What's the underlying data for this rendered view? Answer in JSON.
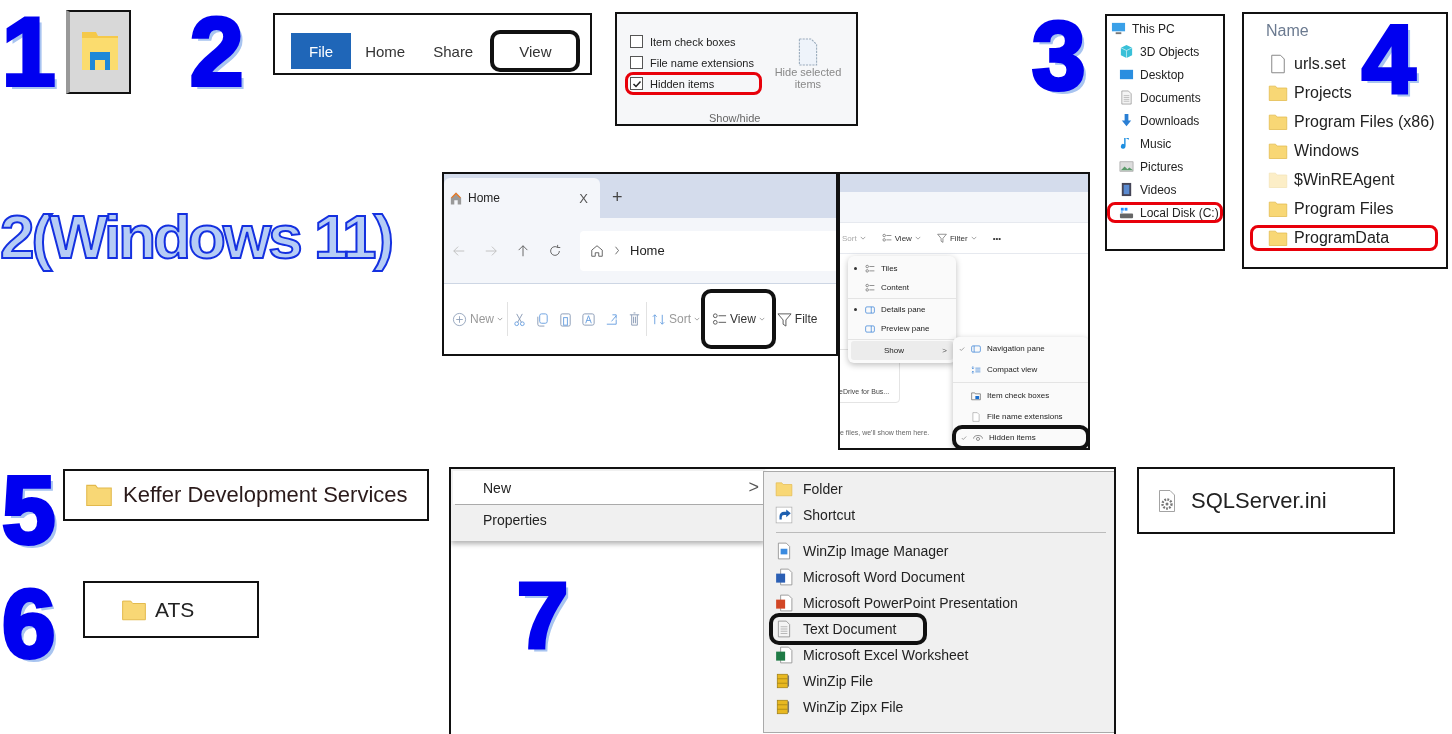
{
  "explorer_icon_step": {
    "step": "1"
  },
  "ribbon_step": {
    "step": "2",
    "tabs": [
      {
        "label": "File",
        "kind": "backstage",
        "highlighted": false
      },
      {
        "label": "Home",
        "kind": "tab",
        "highlighted": false
      },
      {
        "label": "Share",
        "kind": "tab",
        "highlighted": false
      },
      {
        "label": "View",
        "kind": "tab",
        "highlighted": true
      }
    ]
  },
  "show_hide_group": {
    "options": [
      {
        "label": "Item check boxes",
        "checked": false,
        "highlighted": false
      },
      {
        "label": "File name extensions",
        "checked": false,
        "highlighted": false
      },
      {
        "label": "Hidden items",
        "checked": true,
        "highlighted": true
      }
    ],
    "button": "Hide selected items",
    "group_label": "Show/hide"
  },
  "navigation_step": {
    "step": "3",
    "items": [
      {
        "label": "This PC",
        "kind": "pc",
        "highlighted": false
      },
      {
        "label": "3D Objects",
        "kind": "cube",
        "highlighted": false
      },
      {
        "label": "Desktop",
        "kind": "desktop",
        "highlighted": false
      },
      {
        "label": "Documents",
        "kind": "documents",
        "highlighted": false
      },
      {
        "label": "Downloads",
        "kind": "download",
        "highlighted": false
      },
      {
        "label": "Music",
        "kind": "music",
        "highlighted": false
      },
      {
        "label": "Pictures",
        "kind": "pictures",
        "highlighted": false
      },
      {
        "label": "Videos",
        "kind": "videos",
        "highlighted": false
      },
      {
        "label": "Local Disk (C:)",
        "kind": "drive",
        "highlighted": true
      }
    ]
  },
  "folder_list_step": {
    "step": "4",
    "header": "Name",
    "items": [
      {
        "name": "urls.set",
        "kind": "file",
        "hidden": false,
        "highlighted": false
      },
      {
        "name": "Projects",
        "kind": "folder",
        "hidden": false,
        "highlighted": false
      },
      {
        "name": "Program Files (x86)",
        "kind": "folder",
        "hidden": false,
        "highlighted": false
      },
      {
        "name": "Windows",
        "kind": "folder",
        "hidden": false,
        "highlighted": false
      },
      {
        "name": "$WinREAgent",
        "kind": "folder",
        "hidden": true,
        "highlighted": false
      },
      {
        "name": "Program Files",
        "kind": "folder",
        "hidden": false,
        "highlighted": false
      },
      {
        "name": "ProgramData",
        "kind": "folder",
        "hidden": false,
        "highlighted": true
      }
    ]
  },
  "windows11_step": {
    "title": "2(Windows 11)",
    "tab": {
      "label": "Home",
      "close": "X",
      "new_tab": "+"
    },
    "address": "Home",
    "toolbar": [
      {
        "label": "New",
        "kind": "new",
        "highlighted": false
      },
      {
        "kind": "cut",
        "highlighted": false
      },
      {
        "kind": "copy",
        "highlighted": false
      },
      {
        "kind": "paste",
        "highlighted": false
      },
      {
        "kind": "rename",
        "highlighted": false
      },
      {
        "kind": "share",
        "highlighted": false
      },
      {
        "kind": "delete",
        "highlighted": false
      },
      {
        "label": "Sort",
        "kind": "sort",
        "highlighted": false
      },
      {
        "label": "View",
        "kind": "view",
        "highlighted": true
      },
      {
        "label": "Filte",
        "kind": "filter",
        "highlighted": false
      }
    ]
  },
  "view_menu": {
    "toolbar": [
      {
        "label": "Sort",
        "kind": "sort"
      },
      {
        "label": "View",
        "kind": "view"
      },
      {
        "label": "Filter",
        "kind": "filter"
      },
      {
        "label": "•••",
        "kind": "more"
      }
    ],
    "card_text": "eDrive for Bus...",
    "empty_text": "e files, we'll show them here.",
    "items": [
      {
        "label": "Tiles",
        "kind": "tiles",
        "bullet": true,
        "selected": false
      },
      {
        "label": "Content",
        "kind": "content",
        "bullet": false,
        "selected": false
      },
      {
        "label": "Details pane",
        "kind": "details-pane",
        "bullet": true,
        "selected": false
      },
      {
        "label": "Preview pane",
        "kind": "preview-pane",
        "bullet": false,
        "selected": false
      },
      {
        "label": "Show",
        "kind": "submenu",
        "bullet": false,
        "selected": true,
        "arrow": ">"
      }
    ],
    "submenu": [
      {
        "label": "Navigation pane",
        "kind": "nav-pane",
        "checked": true,
        "highlighted": false
      },
      {
        "label": "Compact view",
        "kind": "compact",
        "checked": false,
        "highlighted": false
      },
      {
        "label": "Item check boxes",
        "kind": "checkboxes",
        "checked": false,
        "highlighted": false
      },
      {
        "label": "File name extensions",
        "kind": "extensions",
        "checked": false,
        "highlighted": false
      },
      {
        "label": "Hidden items",
        "kind": "eye",
        "checked": true,
        "highlighted": true
      }
    ]
  },
  "folder_name_step": {
    "step": "5",
    "name": "Keffer Development Services"
  },
  "new_folder_step": {
    "step": "6",
    "name": "ATS"
  },
  "context_menu_step": {
    "step": "7",
    "items": [
      {
        "label": "New",
        "selected": true,
        "arrow": ">"
      },
      {
        "label": "Properties",
        "selected": false
      }
    ],
    "new_items": [
      {
        "label": "Folder",
        "kind": "folder",
        "highlighted": false,
        "separator_after": false
      },
      {
        "label": "Shortcut",
        "kind": "shortcut",
        "highlighted": false,
        "separator_after": true
      },
      {
        "label": "WinZip Image Manager",
        "kind": "image-file",
        "highlighted": false,
        "separator_after": false
      },
      {
        "label": "Microsoft Word Document",
        "kind": "word",
        "highlighted": false,
        "separator_after": false
      },
      {
        "label": "Microsoft PowerPoint Presentation",
        "kind": "powerpoint",
        "highlighted": false,
        "separator_after": false
      },
      {
        "label": "Text Document",
        "kind": "text",
        "highlighted": true,
        "separator_after": false
      },
      {
        "label": "Microsoft Excel Worksheet",
        "kind": "excel",
        "highlighted": false,
        "separator_after": false
      },
      {
        "label": "WinZip File",
        "kind": "zip",
        "highlighted": false,
        "separator_after": false
      },
      {
        "label": "WinZip Zipx File",
        "kind": "zip",
        "highlighted": false,
        "separator_after": false
      }
    ]
  },
  "config_file_step": {
    "name": "SQLServer.ini"
  }
}
